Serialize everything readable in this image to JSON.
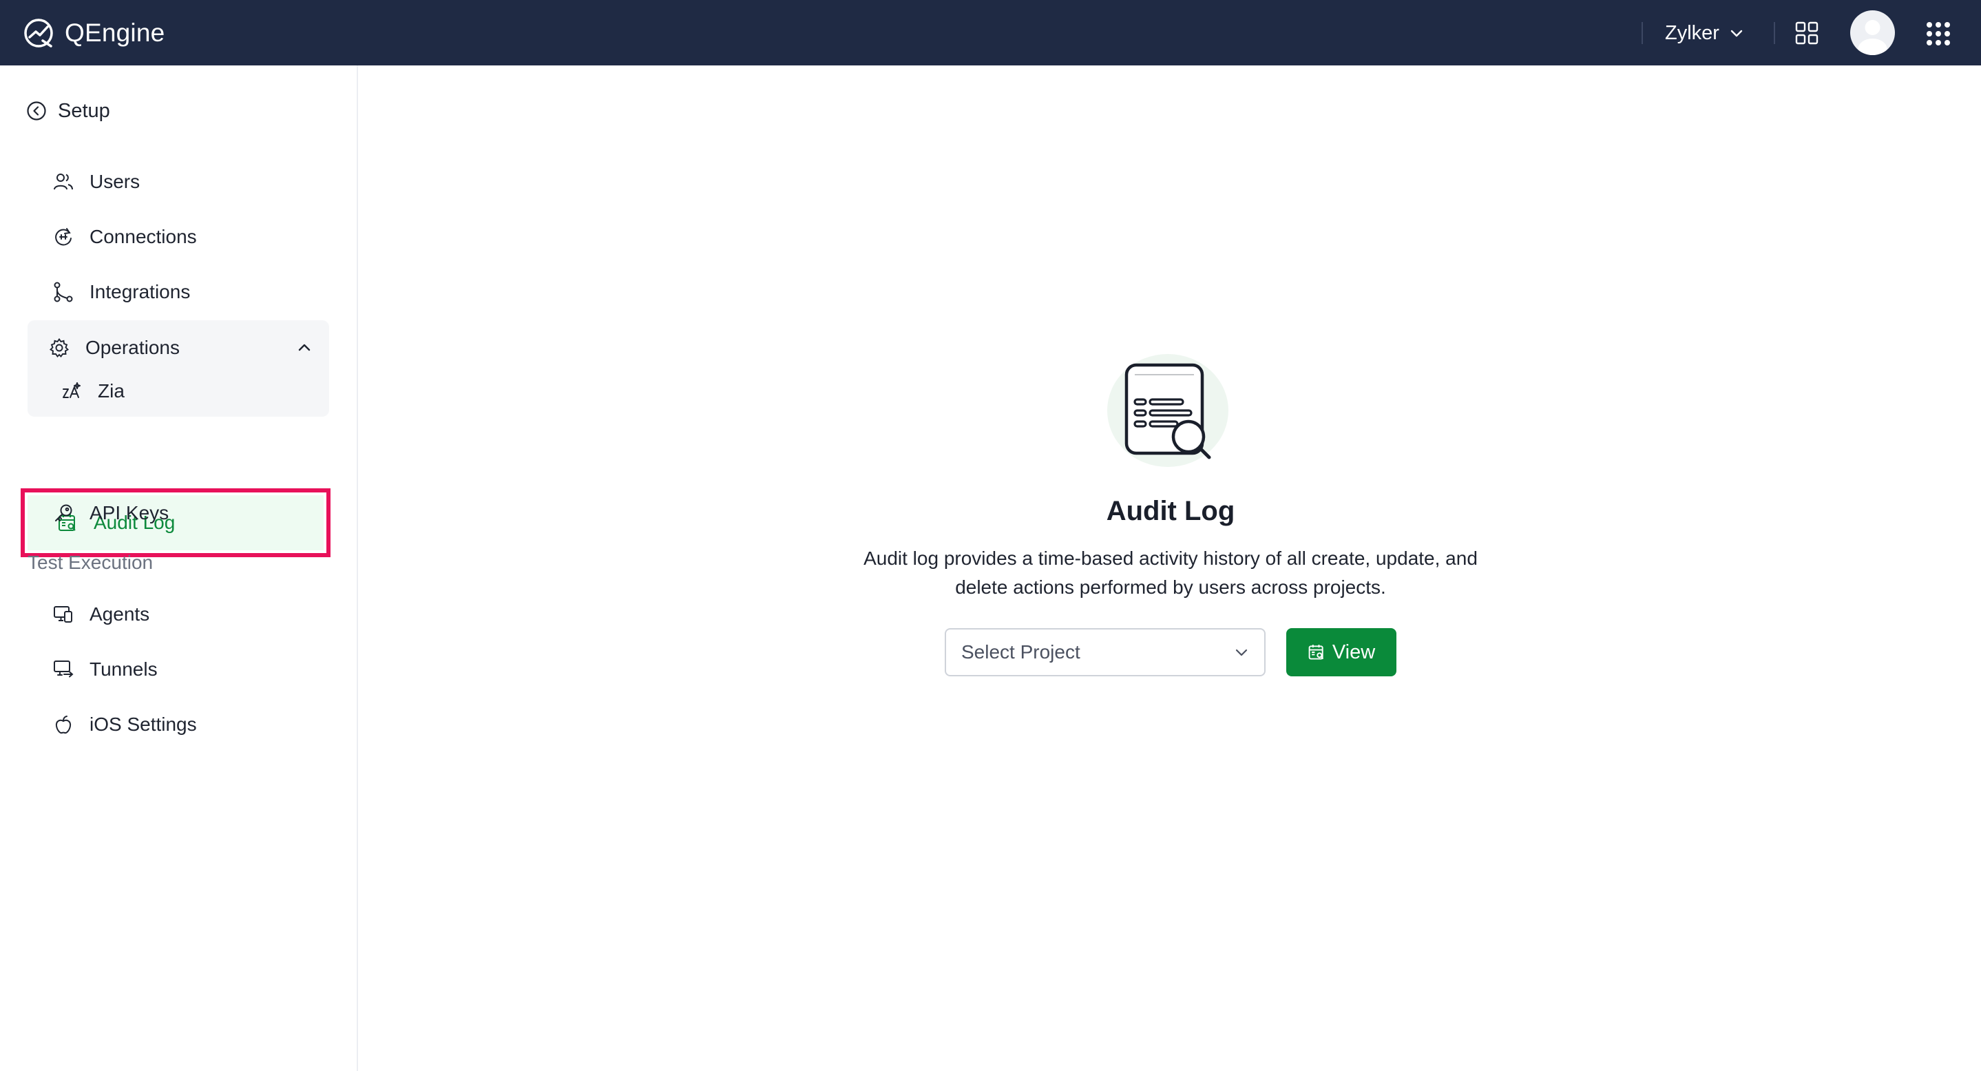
{
  "header": {
    "brand": "QEngine",
    "org_name": "Zylker",
    "icons": [
      "qengine-logo-icon",
      "chevron-down-icon",
      "grid-icon",
      "avatar",
      "app-launcher-icon"
    ]
  },
  "sidebar": {
    "back_label": "Setup",
    "items": [
      {
        "label": "Users",
        "icon": "users-icon"
      },
      {
        "label": "Connections",
        "icon": "connections-icon"
      },
      {
        "label": "Integrations",
        "icon": "integrations-icon"
      }
    ],
    "operations": {
      "label": "Operations",
      "children": [
        {
          "label": "Zia",
          "icon": "zia-icon"
        }
      ]
    },
    "active": {
      "label": "Audit Log",
      "icon": "audit-log-icon"
    },
    "api_keys": {
      "label": "API Keys",
      "icon": "key-icon"
    },
    "section_test_execution": "Test Execution",
    "test_items": [
      {
        "label": "Agents",
        "icon": "agents-icon"
      },
      {
        "label": "Tunnels",
        "icon": "tunnels-icon"
      },
      {
        "label": "iOS Settings",
        "icon": "apple-icon"
      }
    ]
  },
  "main": {
    "title": "Audit Log",
    "description_line1": "Audit log provides a time-based activity history of all create, update, and",
    "description_line2": "delete actions performed by users across projects.",
    "select_placeholder": "Select Project",
    "view_button": "View"
  },
  "colors": {
    "header_bg": "#1f2a44",
    "accent_green": "#0a8a3a",
    "active_bg": "#eefbf2",
    "highlight_border": "#e8115a"
  }
}
